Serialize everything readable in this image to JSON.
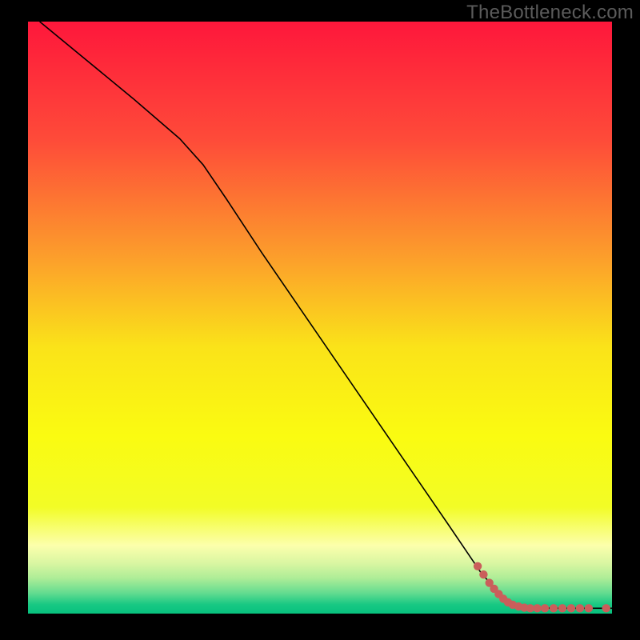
{
  "watermark": "TheBottleneck.com",
  "chart_data": {
    "type": "line",
    "title": "",
    "xlabel": "",
    "ylabel": "",
    "xlim": [
      0,
      100
    ],
    "ylim": [
      0,
      100
    ],
    "background_gradient": {
      "stops": [
        {
          "offset": 0.0,
          "color": "#fe173b"
        },
        {
          "offset": 0.2,
          "color": "#fe4b39"
        },
        {
          "offset": 0.4,
          "color": "#fc9f2b"
        },
        {
          "offset": 0.55,
          "color": "#fae319"
        },
        {
          "offset": 0.7,
          "color": "#fafb11"
        },
        {
          "offset": 0.82,
          "color": "#f2fc26"
        },
        {
          "offset": 0.885,
          "color": "#fcffac"
        },
        {
          "offset": 0.915,
          "color": "#d9f6a2"
        },
        {
          "offset": 0.94,
          "color": "#aeed97"
        },
        {
          "offset": 0.965,
          "color": "#64dc90"
        },
        {
          "offset": 0.985,
          "color": "#17c883"
        },
        {
          "offset": 1.0,
          "color": "#08c17e"
        }
      ]
    },
    "series": [
      {
        "name": "curve",
        "type": "line",
        "color": "#000000",
        "width": 1.6,
        "points": [
          {
            "x": 2.0,
            "y": 100.0
          },
          {
            "x": 10.0,
            "y": 93.5
          },
          {
            "x": 18.0,
            "y": 87.0
          },
          {
            "x": 26.0,
            "y": 80.2
          },
          {
            "x": 30.0,
            "y": 75.8
          },
          {
            "x": 34.0,
            "y": 70.0
          },
          {
            "x": 40.0,
            "y": 61.0
          },
          {
            "x": 48.0,
            "y": 49.5
          },
          {
            "x": 56.0,
            "y": 38.0
          },
          {
            "x": 64.0,
            "y": 26.5
          },
          {
            "x": 72.0,
            "y": 15.0
          },
          {
            "x": 77.5,
            "y": 7.0
          },
          {
            "x": 81.0,
            "y": 3.0
          },
          {
            "x": 83.5,
            "y": 1.4
          },
          {
            "x": 86.0,
            "y": 1.0
          },
          {
            "x": 90.0,
            "y": 0.9
          },
          {
            "x": 95.0,
            "y": 0.9
          },
          {
            "x": 100.0,
            "y": 0.9
          }
        ]
      },
      {
        "name": "dots",
        "type": "scatter",
        "color": "#ca5e5b",
        "radius": 5.2,
        "points": [
          {
            "x": 77.0,
            "y": 8.0
          },
          {
            "x": 78.0,
            "y": 6.6
          },
          {
            "x": 79.0,
            "y": 5.2
          },
          {
            "x": 79.8,
            "y": 4.2
          },
          {
            "x": 80.6,
            "y": 3.3
          },
          {
            "x": 81.4,
            "y": 2.5
          },
          {
            "x": 82.2,
            "y": 1.9
          },
          {
            "x": 83.0,
            "y": 1.5
          },
          {
            "x": 84.0,
            "y": 1.2
          },
          {
            "x": 85.0,
            "y": 1.0
          },
          {
            "x": 86.0,
            "y": 0.9
          },
          {
            "x": 87.2,
            "y": 0.9
          },
          {
            "x": 88.5,
            "y": 0.9
          },
          {
            "x": 90.0,
            "y": 0.9
          },
          {
            "x": 91.5,
            "y": 0.9
          },
          {
            "x": 93.0,
            "y": 0.9
          },
          {
            "x": 94.5,
            "y": 0.9
          },
          {
            "x": 96.0,
            "y": 0.9
          },
          {
            "x": 99.0,
            "y": 0.9
          }
        ]
      }
    ]
  }
}
